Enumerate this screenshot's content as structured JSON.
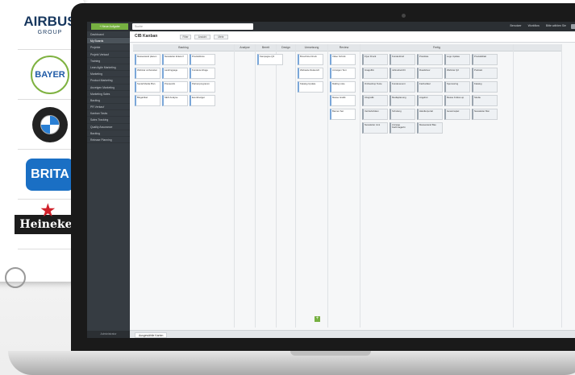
{
  "logos": {
    "airbus": "AIRBUS",
    "airbus_sub": "GROUP",
    "bayer": "BAYER",
    "brita": "BRITA",
    "heineken": "Heineken"
  },
  "topbar": {
    "create_label": "+ Neue Aufgabe",
    "search_placeholder": "Suche",
    "links": [
      "Benutzer",
      "Workflow",
      "Bitte wählen Sie"
    ]
  },
  "sidebar": {
    "items": [
      "Dashboard",
      "My Boards",
      "Projekte",
      "Projekt Verkauf",
      "Training",
      "Lean Agile Marketing",
      "Marketing",
      "Product Marketing",
      "Anzeigen Marketing",
      "Marketing Sales",
      "Backlog",
      "PR Verkauf",
      "Kanban Tasks",
      "Sales Tracking",
      "Quality Assurance",
      "Backlog",
      "Release Planning"
    ],
    "active_index": 1,
    "footer": "Administrator"
  },
  "board": {
    "title": "CIB Kanban",
    "tools": [
      "Filter",
      "Ansicht",
      "Mehr"
    ],
    "lanes": [
      {
        "name": "Backlog",
        "cards": [
          "Messestand planen",
          "Newsletter Entwurf",
          "Produktfotos",
          "Webinar vorbereiten",
          "Landingpage",
          "Kundenumfrage",
          "Social Media Plan",
          "Presseinfo",
          "Partnerprogramm",
          "Blogartikel",
          "SEO Analyse",
          "Eventbudget"
        ]
      },
      {
        "name": "Analyse",
        "cards": []
      },
      {
        "name": "Bereit",
        "cards": [
          "Kampagne Q3"
        ]
      },
      {
        "name": "Design",
        "cards": []
      },
      {
        "name": "Umsetzung",
        "cards": [
          "Broschüre Druck",
          "Webseite Relaunch",
          "Katalog Update"
        ]
      },
      {
        "name": "Review",
        "cards": [
          "Video Schnitt",
          "Anzeigen Text",
          "Mailing Liste",
          "Messe Grafik",
          "Banner Set"
        ]
      },
      {
        "name": "Fertig",
        "cards": [
          "Flyer Druck",
          "Kundenbrief",
          "Preisliste",
          "Logo Update",
          "Produktblatt",
          "Imagefilm",
          "Jahresbericht",
          "Roadshow",
          "Webinar Q2",
          "Podcast",
          "Onlineshop Texte",
          "Kundenevent",
          "Fachartikel",
          "Sponsoring",
          "Katalog",
          "Infografik",
          "Mediaplanung",
          "Angebot",
          "Messe Follow-up",
          "Studie",
          "Vertriebsfolien",
          "Schulung",
          "Händlerportal",
          "Gewinnspiel",
          "Newsletter Mai",
          "Newsletter Juni",
          "Anzeige Fachmagazin",
          "Messestand Bau"
        ]
      },
      {
        "name": "",
        "cards": []
      }
    ]
  },
  "bottom": {
    "tab_label": "Ausgewählte Karten"
  },
  "colors": {
    "accent": "#76b041",
    "sidebar": "#363c42",
    "topbar": "#2b2f33",
    "card_border": "#7aa7d9"
  }
}
